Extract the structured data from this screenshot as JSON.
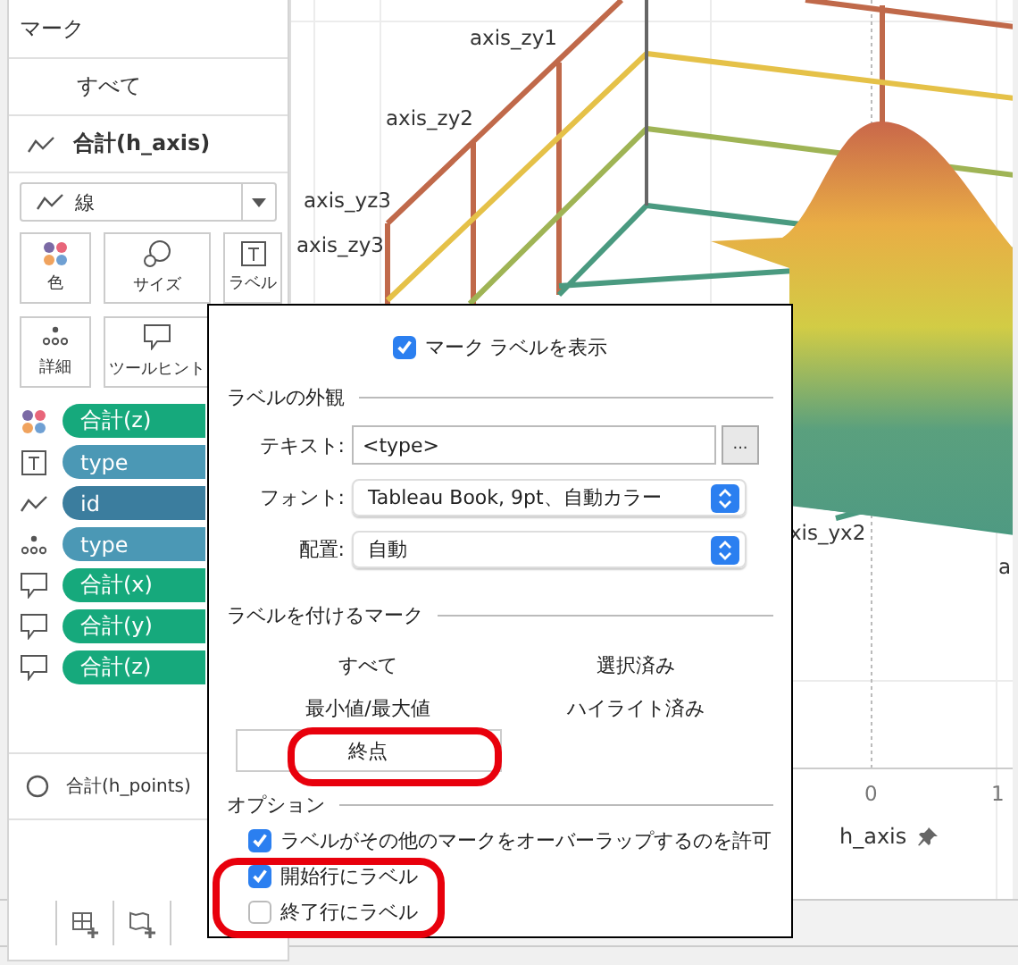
{
  "marks_panel": {
    "title": "マーク",
    "all_row": "すべて",
    "layer": {
      "label": "合計(h_axis)"
    },
    "mark_type": {
      "value": "線"
    },
    "mark_buttons": [
      {
        "kind": "color",
        "label": "色"
      },
      {
        "kind": "size",
        "label": "サイズ"
      },
      {
        "kind": "label",
        "label": "ラベル"
      },
      {
        "kind": "detail",
        "label": "詳細"
      },
      {
        "kind": "tooltip",
        "label": "ツールヒント"
      }
    ],
    "pills": [
      {
        "kind": "color",
        "field": "合計(z)",
        "color": "#16a97c"
      },
      {
        "kind": "label",
        "field": "type",
        "color": "#4b98b5"
      },
      {
        "kind": "path",
        "field": "id",
        "color": "#3b7d9e"
      },
      {
        "kind": "detail",
        "field": "type",
        "color": "#4b98b5"
      },
      {
        "kind": "tooltip",
        "field": "合計(x)",
        "color": "#16a97c"
      },
      {
        "kind": "tooltip",
        "field": "合計(y)",
        "color": "#16a97c"
      },
      {
        "kind": "tooltip",
        "field": "合計(z)",
        "color": "#16a97c"
      }
    ],
    "second_layer": {
      "label": "合計(h_points)"
    }
  },
  "chart": {
    "axis_labels": [
      {
        "text": "axis_zy1"
      },
      {
        "text": "axis_zy2"
      },
      {
        "text": "axis_yz3"
      },
      {
        "text": "axis_zy3"
      },
      {
        "text": "xis_yx2"
      },
      {
        "text": "a"
      }
    ],
    "x_ticks": [
      "0",
      "1"
    ],
    "x_axis_title": "h_axis"
  },
  "label_dialog": {
    "show_labels": {
      "label": "マーク ラベルを表示",
      "checked": true
    },
    "appearance": {
      "title": "ラベルの外観",
      "text_label": "テキスト:",
      "text_value": "<type>",
      "more_button": "...",
      "font_label": "フォント:",
      "font_value": "Tableau Book, 9pt、自動カラー",
      "align_label": "配置:",
      "align_value": "自動"
    },
    "marks_to_label": {
      "title": "ラベルを付けるマーク",
      "options": [
        {
          "label": "すべて",
          "selected": false
        },
        {
          "label": "選択済み",
          "selected": false
        },
        {
          "label": "最小値/最大値",
          "selected": false
        },
        {
          "label": "ハイライト済み",
          "selected": false
        },
        {
          "label": "終点",
          "selected": true
        }
      ]
    },
    "options": {
      "title": "オプション",
      "checkboxes": [
        {
          "label": "ラベルがその他のマークをオーバーラップするのを許可",
          "checked": true
        },
        {
          "label": "開始行にラベル",
          "checked": true
        },
        {
          "label": "終了行にラベル",
          "checked": false
        }
      ]
    }
  }
}
